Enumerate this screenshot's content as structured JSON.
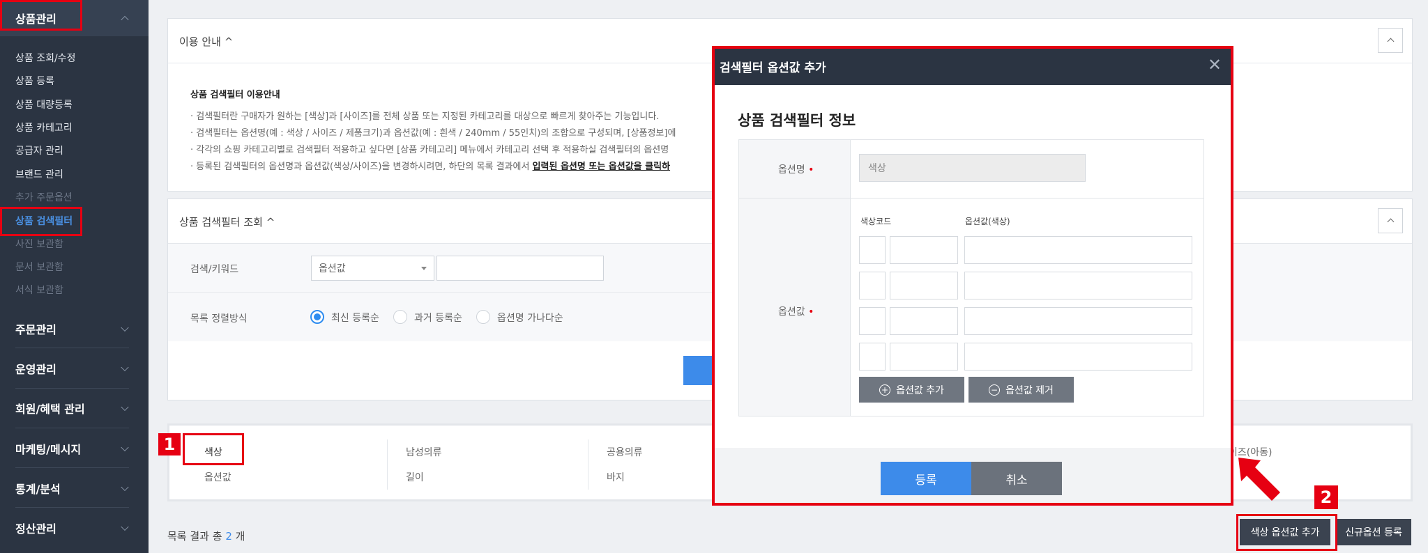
{
  "sidebar": {
    "product_mgmt": "상품관리",
    "sub_items": [
      "상품 조회/수정",
      "상품 등록",
      "상품 대량등록",
      "상품 카테고리",
      "공급자 관리",
      "브랜드 관리",
      "추가 주문옵션",
      "상품 검색필터",
      "사진 보관함",
      "문서 보관함",
      "서식 보관함"
    ],
    "main_items": [
      "주문관리",
      "운영관리",
      "회원/혜택 관리",
      "마케팅/메시지",
      "통계/분석",
      "정산관리"
    ]
  },
  "guide": {
    "title": "이용 안내 ^",
    "heading": "상품 검색필터 이용안내",
    "lines": [
      "· 검색필터란 구매자가 원하는 [색상]과 [사이즈]를 전체 상품 또는 지정된 카테고리를 대상으로 빠르게 찾아주는 기능입니다.",
      "· 검색필터는 옵션명(예 : 색상 / 사이즈 / 제품크기)과 옵션값(예 : 흰색 / 240mm / 55인치)의 조합으로 구성되며, [상품정보]에",
      "· 각각의 쇼핑 카테고리별로 검색필터 적용하고 싶다면 [상품 카테고리] 메뉴에서 카테고리 선택 후 적용하실 검색필터의 옵션명",
      "· 등록된 검색필터의 옵션명과 옵션값(색상/사이즈)을 변경하시려면, 하단의 목록 결과에서 "
    ],
    "bold_tail": "입력된 옵션명 또는 옵션값을 클릭하"
  },
  "search": {
    "title": "상품 검색필터 조회 ^",
    "keyword_label": "검색/키워드",
    "select_value": "옵션값",
    "sort_label": "목록 정렬방식",
    "sort_options": [
      "최신 등록순",
      "과거 등록순",
      "옵션명 가나다순"
    ]
  },
  "results": {
    "cols": [
      {
        "name": "색상",
        "value": "옵션값"
      },
      {
        "name": "남성의류",
        "value": "길이"
      },
      {
        "name": "공용의류",
        "value": "바지"
      }
    ],
    "partial_right": "이즈(아동)",
    "count_prefix": "목록 결과 총 ",
    "count": "2",
    "count_suffix": " 개"
  },
  "buttons": {
    "color_add": "색상 옵션값 추가",
    "new_option": "신규옵션 등록"
  },
  "badges": {
    "one": "1",
    "two": "2"
  },
  "modal": {
    "title": "검색필터 옵션값 추가",
    "close": "✕",
    "section_title": "상품 검색필터 정보",
    "option_name_label": "옵션명",
    "option_name_value": "색상",
    "option_value_label": "옵션값",
    "req_mark": "•",
    "color_code_header": "색상코드",
    "color_value_header": "옵션값(색상)",
    "add_value_btn": "옵션값 추가",
    "remove_value_btn": "옵션값 제거",
    "plus": "+",
    "minus": "−",
    "submit": "등록",
    "cancel": "취소"
  },
  "colors": {
    "accent": "#3d8bea",
    "highlight": "#e60012",
    "sidebar": "#2b3442"
  }
}
